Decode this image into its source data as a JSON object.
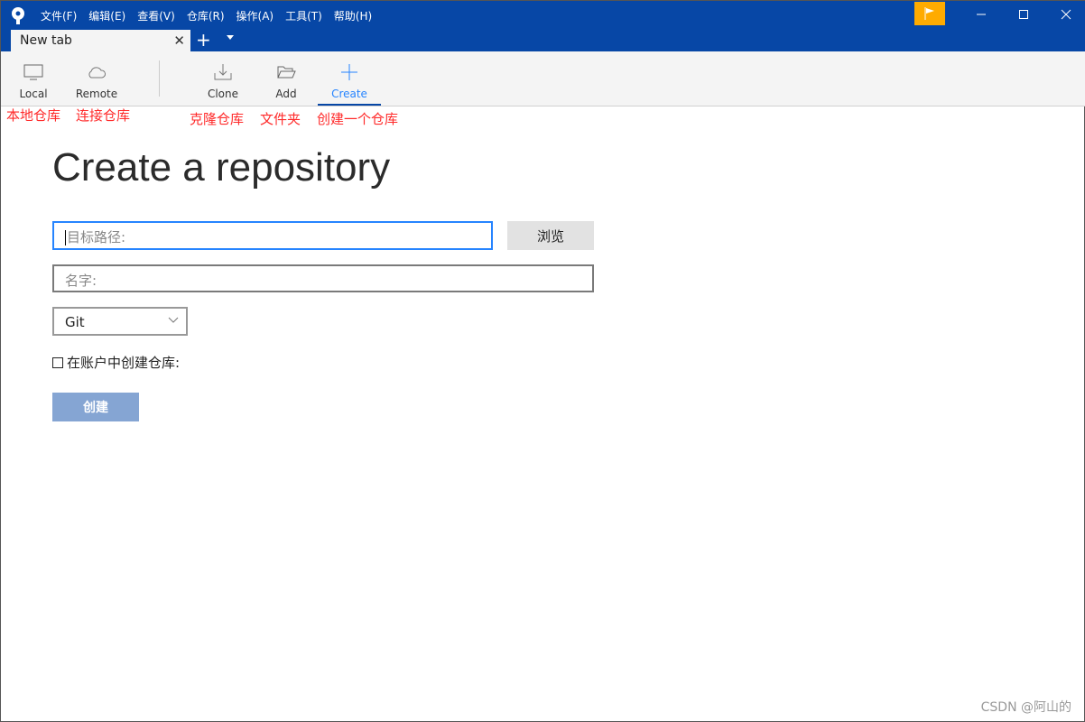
{
  "menu": [
    "文件(F)",
    "编辑(E)",
    "查看(V)",
    "仓库(R)",
    "操作(A)",
    "工具(T)",
    "帮助(H)"
  ],
  "tab": {
    "label": "New tab"
  },
  "toolbar": {
    "local": "Local",
    "remote": "Remote",
    "clone": "Clone",
    "add": "Add",
    "create": "Create"
  },
  "notes": {
    "local": "本地仓库",
    "remote": "连接仓库",
    "clone": "克隆仓库",
    "add": "文件夹",
    "create": "创建一个仓库"
  },
  "page": {
    "title": "Create a repository",
    "path_placeholder": "目标路径:",
    "browse": "浏览",
    "name_placeholder": "名字:",
    "repo_type": "Git",
    "account_checkbox": "在账户中创建仓库:",
    "account_checked": false,
    "create_button": "创建"
  },
  "watermark": "CSDN @阿山的",
  "colors": {
    "titlebar": "#0747a6",
    "accent": "#2684ff",
    "flag": "#ffab00",
    "annotation": "#ff2a2a"
  }
}
